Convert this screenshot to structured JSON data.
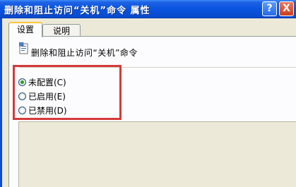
{
  "window": {
    "title": "删除和阻止访问“关机”命令 属性",
    "help_button": "?",
    "close_button": "X"
  },
  "tabs": [
    {
      "label": "设置",
      "active": true
    },
    {
      "label": "说明",
      "active": false
    }
  ],
  "policy": {
    "icon": "policy-document-icon",
    "name": "删除和阻止访问“关机”命令"
  },
  "options": [
    {
      "label": "未配置(C)",
      "checked": true
    },
    {
      "label": "已启用(E)",
      "checked": false
    },
    {
      "label": "已禁用(D)",
      "checked": false
    }
  ],
  "colors": {
    "titlebar": "#0a55e0",
    "highlight_box": "#d43a3a",
    "active_tab_accent": "#ffc83c"
  }
}
